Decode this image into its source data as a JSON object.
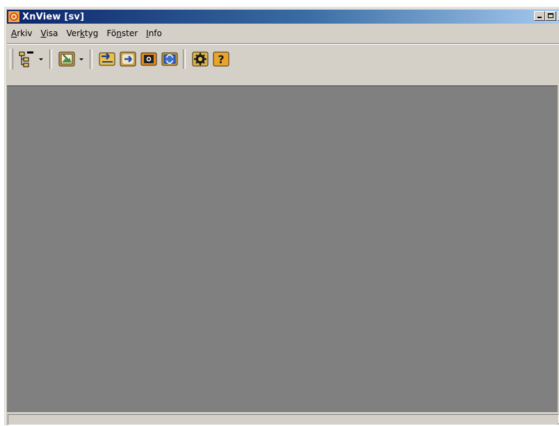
{
  "window": {
    "title": "XnView [sv]"
  },
  "menu": [
    "Arkiv",
    "Visa",
    "Verktyg",
    "Fönster",
    "Info"
  ],
  "menu_mnemonics": [
    {
      "first": "A",
      "rest": "rkiv"
    },
    {
      "first": "V",
      "rest": "isa"
    },
    {
      "pre": "Ver",
      "mn": "k",
      "post": "tyg"
    },
    {
      "pre": "Fö",
      "mn": "n",
      "post": "ster"
    },
    {
      "first": "I",
      "rest": "nfo"
    }
  ],
  "toolbar": {
    "icons": [
      "tree-icon",
      "browse-icon",
      "import-icon",
      "convert-icon",
      "capture-icon",
      "refresh-icon",
      "settings-icon",
      "help-icon"
    ]
  },
  "status": {
    "text": ""
  },
  "colors": {
    "workspace": "#808080",
    "titlebar_start": "#0a246a",
    "titlebar_end": "#a6caf0",
    "chrome": "#d4d0c8"
  }
}
